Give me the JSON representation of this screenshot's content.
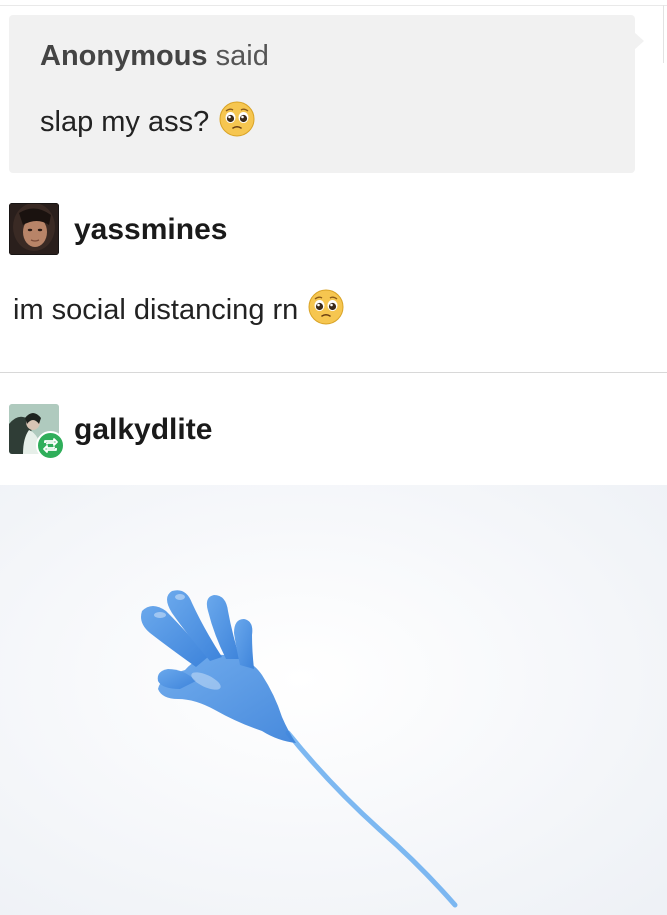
{
  "ask": {
    "asker_name": "Anonymous",
    "asker_verb": "said",
    "question": "slap my ass?",
    "question_emoji": "pleading-face-icon"
  },
  "reply_post": {
    "username": "yassmines",
    "text": "im social distancing rn",
    "text_emoji": "pleading-face-icon"
  },
  "reblog_post": {
    "username": "galkydlite",
    "badge_icon": "reblog-icon",
    "image": "sticky-hand-toy-image"
  },
  "colors": {
    "ask_background": "#f1f1f1",
    "reblog_badge": "#2fae5a",
    "sticky_hand": "#4a90e2"
  }
}
